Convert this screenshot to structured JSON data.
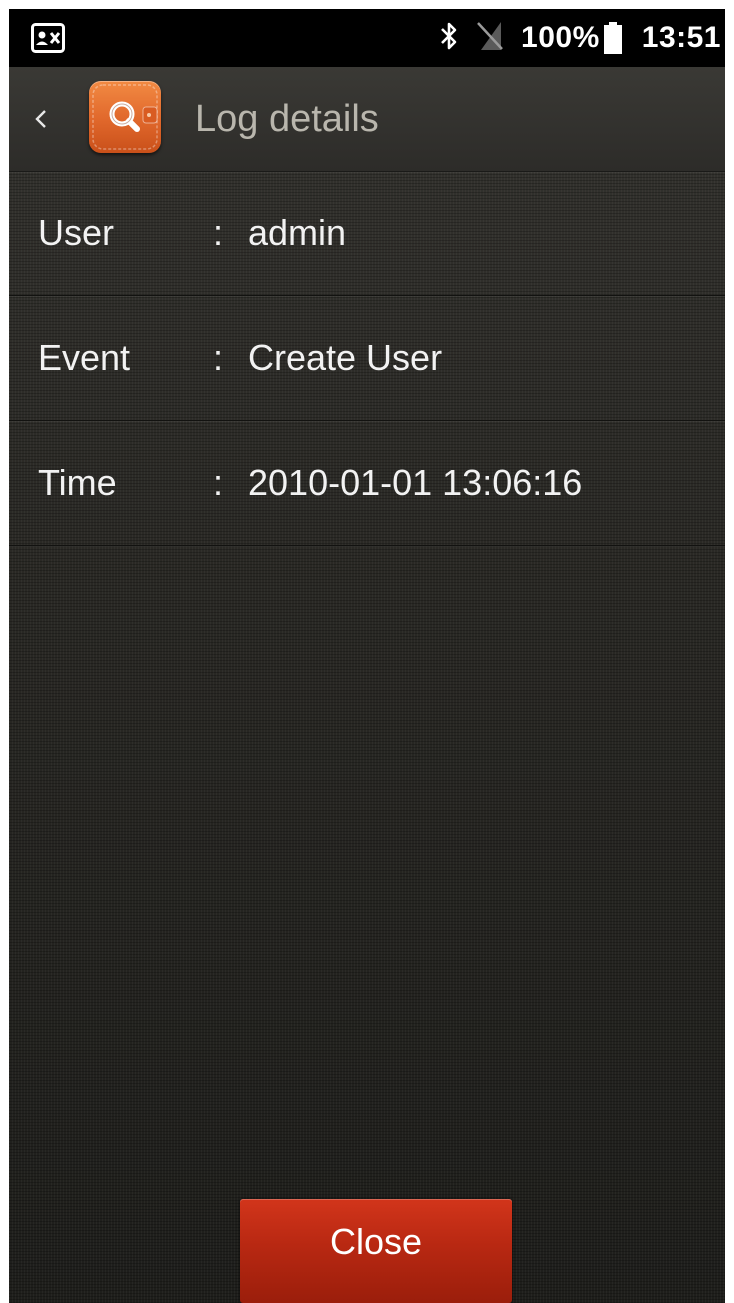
{
  "status_bar": {
    "left_icon": "contact-card-icon",
    "bluetooth_icon": "bluetooth-icon",
    "signal_icon": "no-sim-icon",
    "battery_percent": "100%",
    "battery_icon": "battery-full-icon",
    "time": "13:51"
  },
  "action_bar": {
    "back_icon": "chevron-left-icon",
    "app_icon": "log-search-icon",
    "title": "Log details"
  },
  "details": {
    "rows": [
      {
        "label": "User",
        "separator": ":",
        "value": "admin"
      },
      {
        "label": "Event",
        "separator": ":",
        "value": "Create User"
      },
      {
        "label": "Time",
        "separator": ":",
        "value": "2010-01-01 13:06:16"
      }
    ]
  },
  "footer": {
    "close_label": "Close"
  },
  "colors": {
    "background": "#2b2a26",
    "title_text": "#b9b6ad",
    "app_icon_orange": "#e0672b",
    "close_button_red": "#b82812"
  }
}
